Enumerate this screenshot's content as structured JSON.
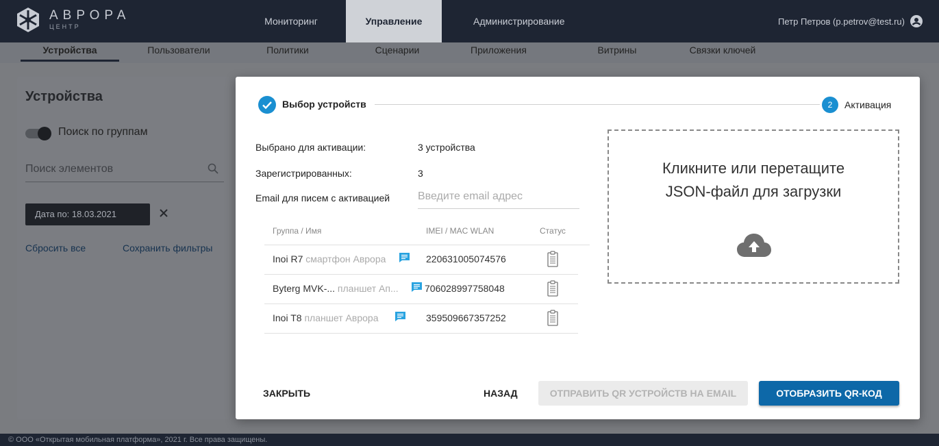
{
  "app": {
    "logo_title": "АВРОРА",
    "logo_subtitle": "ЦЕНТР",
    "user": "Петр Петров (p.petrov@test.ru)"
  },
  "main_nav": [
    "Мониторинг",
    "Управление",
    "Администрирование"
  ],
  "main_nav_active": "Управление",
  "sub_nav": [
    "Устройства",
    "Пользователи",
    "Политики",
    "Сценарии",
    "Приложения",
    "Витрины",
    "Связки ключей"
  ],
  "sub_nav_active": "Устройства",
  "left_panel": {
    "title": "Устройства",
    "toggle_label": "Поиск по группам",
    "search_placeholder": "Поиск элементов",
    "filter_chip": "Дата по: 18.03.2021",
    "reset_all": "Сбросить все",
    "save_filters": "Сохранить фильтры"
  },
  "modal": {
    "step1_label": "Выбор устройств",
    "step2_number": "2",
    "step2_label": "Активация",
    "selected_label": "Выбрано для активации:",
    "selected_value": "3 устройства",
    "registered_label": "Зарегистрированных:",
    "registered_value": "3",
    "email_label": "Email для писем с активацией",
    "email_placeholder": "Введите email адрес",
    "table": {
      "headers": [
        "Группа / Имя",
        "IMEI / MAC WLAN",
        "Статус"
      ],
      "rows": [
        {
          "name": "Inoi R7",
          "model": "смартфон Аврора",
          "imei": "220631005074576"
        },
        {
          "name": "Byterg MVK-...",
          "model": "планшет Ап...",
          "imei": "706028997758048"
        },
        {
          "name": "Inoi T8",
          "model": "планшет Аврора",
          "imei": "359509667357252"
        }
      ]
    },
    "dropzone_line1": "Кликните или перетащите",
    "dropzone_line2": "JSON-файл для загрузки",
    "buttons": {
      "close": "ЗАКРЫТЬ",
      "back": "НАЗАД",
      "send_qr_email": "ОТПРАВИТЬ QR УСТРОЙСТВ НА EMAIL",
      "show_qr": "ОТОБРАЗИТЬ QR-КОД"
    }
  },
  "footer": "© ООО «Открытая мобильная платформа», 2021 г. Все права защищены.",
  "colors": {
    "topbar": "#1e2533",
    "accent": "#1a8fd1",
    "primary_button": "#0d68a8",
    "message_icon": "#29a3e0"
  }
}
